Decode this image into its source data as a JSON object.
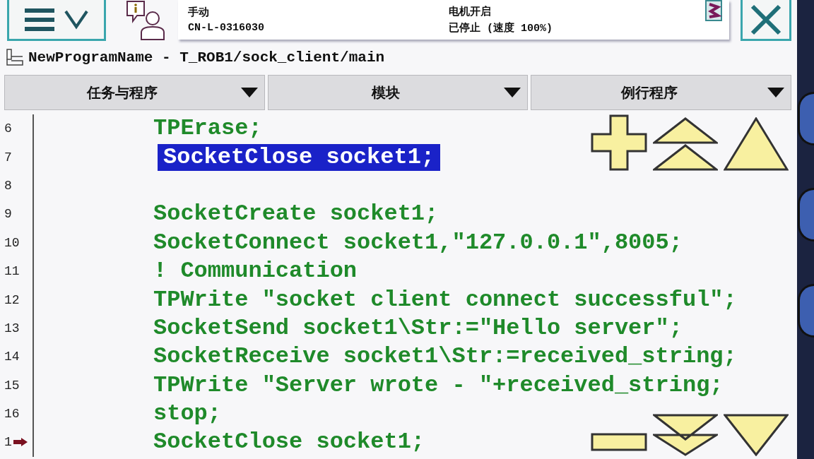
{
  "status": {
    "mode": "手动",
    "controller": "CN-L-0316030",
    "motors": "电机开启",
    "state": "已停止 (速度 100%)"
  },
  "path": "NewProgramName - T_ROB1/sock_client/main",
  "selectors": [
    {
      "label": "任务与程序"
    },
    {
      "label": "模块"
    },
    {
      "label": "例行程序"
    }
  ],
  "lines": [
    {
      "number": "6",
      "code": "TPErase;",
      "selected": false,
      "pointer": false
    },
    {
      "number": "7",
      "code": "SocketClose socket1;",
      "selected": true,
      "pointer": false
    },
    {
      "number": "8",
      "pointer": false
    },
    {
      "number": "9",
      "code": "SocketCreate socket1;",
      "selected": false,
      "pointer": false
    },
    {
      "number": "10",
      "code": "SocketConnect socket1,\"127.0.0.1\",8005;",
      "selected": false,
      "pointer": false
    },
    {
      "number": "11",
      "code": "! Communication",
      "selected": false,
      "pointer": false
    },
    {
      "number": "12",
      "code": "TPWrite \"socket client connect successful\";",
      "selected": false,
      "pointer": false
    },
    {
      "number": "13",
      "code": "SocketSend socket1\\Str:=\"Hello server\";",
      "selected": false,
      "pointer": false
    },
    {
      "number": "14",
      "code": "SocketReceive socket1\\Str:=received_string;",
      "selected": false,
      "pointer": false
    },
    {
      "number": "15",
      "code": "TPWrite \"Server wrote - \"+received_string;",
      "selected": false,
      "pointer": false
    },
    {
      "number": "16",
      "code": "stop;",
      "selected": false,
      "pointer": false
    },
    {
      "number": "1",
      "code": "SocketClose socket1;",
      "selected": false,
      "pointer": true
    }
  ]
}
